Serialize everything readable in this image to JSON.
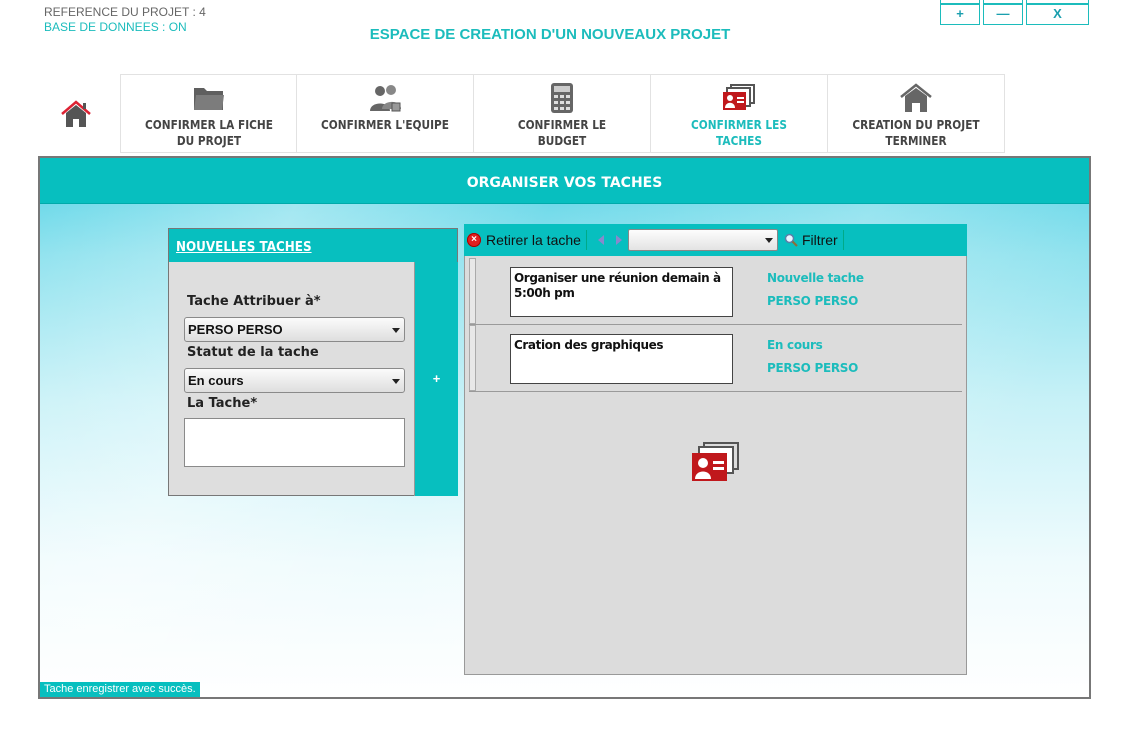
{
  "header": {
    "reference": "REFERENCE DU PROJET : 4",
    "database": "BASE DE DONNEES : ON",
    "title": "ESPACE DE CREATION D'UN NOUVEAUX PROJET"
  },
  "window_controls": {
    "maximize": "+",
    "minimize": "—",
    "close": "X"
  },
  "nav": {
    "home_icon": "home-icon",
    "items": [
      {
        "label": "CONFIRMER LA FICHE DU PROJET",
        "icon": "folder-icon",
        "active": false
      },
      {
        "label": "CONFIRMER L'EQUIPE",
        "icon": "team-icon",
        "active": false
      },
      {
        "label": "CONFIRMER LE BUDGET",
        "icon": "calculator-icon",
        "active": false
      },
      {
        "label": "CONFIRMER LES TACHES",
        "icon": "task-cards-icon",
        "active": true
      },
      {
        "label": "CREATION DU PROJET TERMINER",
        "icon": "house-icon",
        "active": false
      }
    ]
  },
  "main": {
    "title": "ORGANISER VOS TACHES",
    "status_message": "Tache enregistrer avec succès."
  },
  "new_task": {
    "title": "NOUVELLES TACHES",
    "assigned_label": "Tache Attribuer à*",
    "assigned_value": "PERSO PERSO",
    "status_label": "Statut de la tache",
    "status_value": "En cours",
    "task_label": "La Tache*",
    "task_value": "",
    "add_label": "+"
  },
  "task_list": {
    "remove_label": "Retirer la tache",
    "filter_label": "Filtrer",
    "filter_value": "",
    "tasks": [
      {
        "description": "Organiser une réunion demain à 5:00h pm",
        "status": "Nouvelle tache",
        "owner": "PERSO PERSO"
      },
      {
        "description": "Cration des graphiques",
        "status": "En cours",
        "owner": "PERSO PERSO"
      }
    ]
  },
  "colors": {
    "accent": "#07bfbf",
    "accent_text": "#1cbcbc",
    "danger": "#c0181c"
  }
}
